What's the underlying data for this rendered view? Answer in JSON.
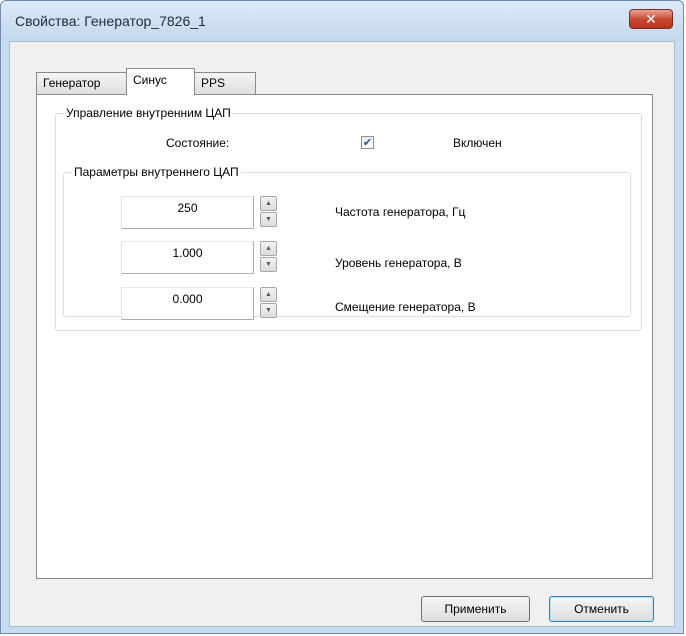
{
  "window": {
    "title": "Свойства: Генератор_7826_1",
    "close_glyph": "✕"
  },
  "tabs": [
    {
      "label": "Генератор",
      "active": false
    },
    {
      "label": "Синус",
      "active": true
    },
    {
      "label": "PPS",
      "active": false
    }
  ],
  "dac_control": {
    "legend": "Управление внутренним ЦАП",
    "state_label": "Состояние:",
    "enabled_checked": true,
    "check_glyph": "✔",
    "enabled_label": "Включен"
  },
  "dac_params": {
    "legend": "Параметры внутреннего ЦАП",
    "fields": [
      {
        "value": "250",
        "label": "Частота генератора, Гц"
      },
      {
        "value": "1.000",
        "label": "Уровень генератора, В"
      },
      {
        "value": "0.000",
        "label": "Смещение генератора, В"
      }
    ]
  },
  "spin_glyphs": {
    "up": "▲",
    "down": "▼"
  },
  "buttons": {
    "apply": "Применить",
    "cancel": "Отменить"
  },
  "colors": {
    "window_frame": "#c9dcef",
    "close_button": "#c8452c",
    "default_button_border": "#3c7fb1"
  }
}
